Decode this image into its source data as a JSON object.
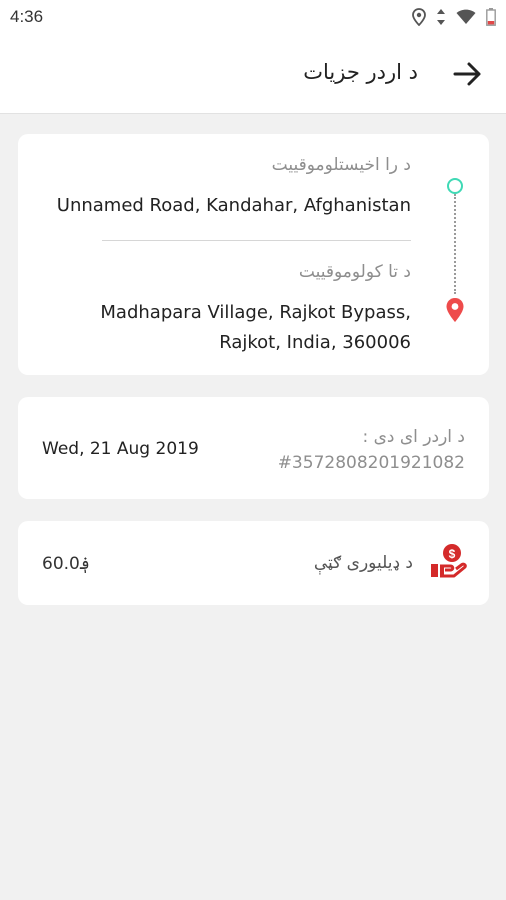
{
  "status_bar": {
    "time": "4:36",
    "icons": [
      "location-icon",
      "data-arrows-icon",
      "wifi-icon",
      "battery-icon"
    ]
  },
  "app_bar": {
    "title": "د اردر جزیات",
    "back_icon": "arrow-right-icon"
  },
  "route": {
    "pickup_label": "د را اخیستلوموقییت",
    "pickup_address": "Unnamed Road, Kandahar, Afghanistan",
    "dropoff_label": "د تا کولوموقییت",
    "dropoff_address_line1": "Madhapara Village, Rajkot Bypass,",
    "dropoff_address_line2": "Rajkot, India, 360006",
    "colors": {
      "start_dot": "#3fd9b5",
      "pin": "#ee4b4b"
    }
  },
  "order": {
    "date": "Wed, 21 Aug 2019",
    "id_label": "د اردر ای دی :",
    "id_value": "#3572808201921082"
  },
  "fee": {
    "label": "د ډیلیوری ګټې",
    "amount": "60.0؋",
    "icon": "money-hand-icon",
    "icon_color": "#d42a2a"
  }
}
